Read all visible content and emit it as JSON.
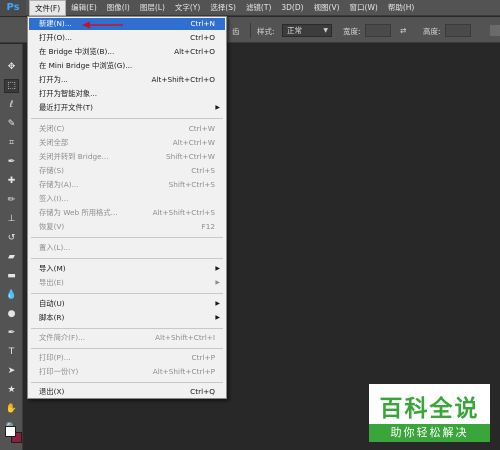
{
  "app": {
    "logo": "Ps"
  },
  "menubar": {
    "items": [
      "文件(F)",
      "编辑(E)",
      "图像(I)",
      "图层(L)",
      "文字(Y)",
      "选择(S)",
      "滤镜(T)",
      "3D(D)",
      "视图(V)",
      "窗口(W)",
      "帮助(H)"
    ],
    "active": "文件(F)"
  },
  "options_bar": {
    "partial_label": "齿",
    "style_label": "样式:",
    "style_value": "正常",
    "width_label": "宽度:",
    "height_label": "高度:"
  },
  "file_menu": [
    {
      "label": "新建(N)...",
      "shortcut": "Ctrl+N",
      "state": "highlight"
    },
    {
      "label": "打开(O)...",
      "shortcut": "Ctrl+O",
      "state": "enabled"
    },
    {
      "label": "在 Bridge 中浏览(B)...",
      "shortcut": "Alt+Ctrl+O",
      "state": "enabled"
    },
    {
      "label": "在 Mini Bridge 中浏览(G)...",
      "shortcut": "",
      "state": "enabled"
    },
    {
      "label": "打开为...",
      "shortcut": "Alt+Shift+Ctrl+O",
      "state": "enabled"
    },
    {
      "label": "打开为智能对象...",
      "shortcut": "",
      "state": "enabled"
    },
    {
      "label": "最近打开文件(T)",
      "shortcut": "",
      "state": "enabled",
      "submenu": true
    },
    {
      "label": "关闭(C)",
      "shortcut": "Ctrl+W",
      "state": "disabled"
    },
    {
      "label": "关闭全部",
      "shortcut": "Alt+Ctrl+W",
      "state": "disabled"
    },
    {
      "label": "关闭并转到 Bridge...",
      "shortcut": "Shift+Ctrl+W",
      "state": "disabled"
    },
    {
      "label": "存储(S)",
      "shortcut": "Ctrl+S",
      "state": "disabled"
    },
    {
      "label": "存储为(A)...",
      "shortcut": "Shift+Ctrl+S",
      "state": "disabled"
    },
    {
      "label": "签入(I)...",
      "shortcut": "",
      "state": "disabled"
    },
    {
      "label": "存储为 Web 所用格式...",
      "shortcut": "Alt+Shift+Ctrl+S",
      "state": "disabled"
    },
    {
      "label": "恢复(V)",
      "shortcut": "F12",
      "state": "disabled"
    },
    {
      "label": "置入(L)...",
      "shortcut": "",
      "state": "disabled"
    },
    {
      "label": "导入(M)",
      "shortcut": "",
      "state": "enabled",
      "submenu": true
    },
    {
      "label": "导出(E)",
      "shortcut": "",
      "state": "disabled",
      "submenu": true
    },
    {
      "label": "自动(U)",
      "shortcut": "",
      "state": "enabled",
      "submenu": true
    },
    {
      "label": "脚本(R)",
      "shortcut": "",
      "state": "enabled",
      "submenu": true
    },
    {
      "label": "文件简介(F)...",
      "shortcut": "Alt+Shift+Ctrl+I",
      "state": "disabled"
    },
    {
      "label": "打印(P)...",
      "shortcut": "Ctrl+P",
      "state": "disabled"
    },
    {
      "label": "打印一份(Y)",
      "shortcut": "Alt+Shift+Ctrl+P",
      "state": "disabled"
    },
    {
      "label": "退出(X)",
      "shortcut": "Ctrl+Q",
      "state": "enabled"
    }
  ],
  "watermark": {
    "top": "百科全说",
    "bottom": "助你轻松解决"
  },
  "colors": {
    "highlight": "#2f6fcf",
    "arrow": "#c8102e",
    "watermark_green": "#3aa53a",
    "background_swatch": "#8d1f3c"
  },
  "icons": [
    "move-icon",
    "marquee-icon",
    "lasso-icon",
    "quick-select-icon",
    "crop-icon",
    "eyedropper-icon",
    "healing-brush-icon",
    "brush-icon",
    "clone-stamp-icon",
    "history-brush-icon",
    "eraser-icon",
    "gradient-icon",
    "blur-icon",
    "dodge-icon",
    "pen-icon",
    "type-icon",
    "path-select-icon",
    "shape-icon",
    "hand-icon",
    "zoom-icon"
  ]
}
